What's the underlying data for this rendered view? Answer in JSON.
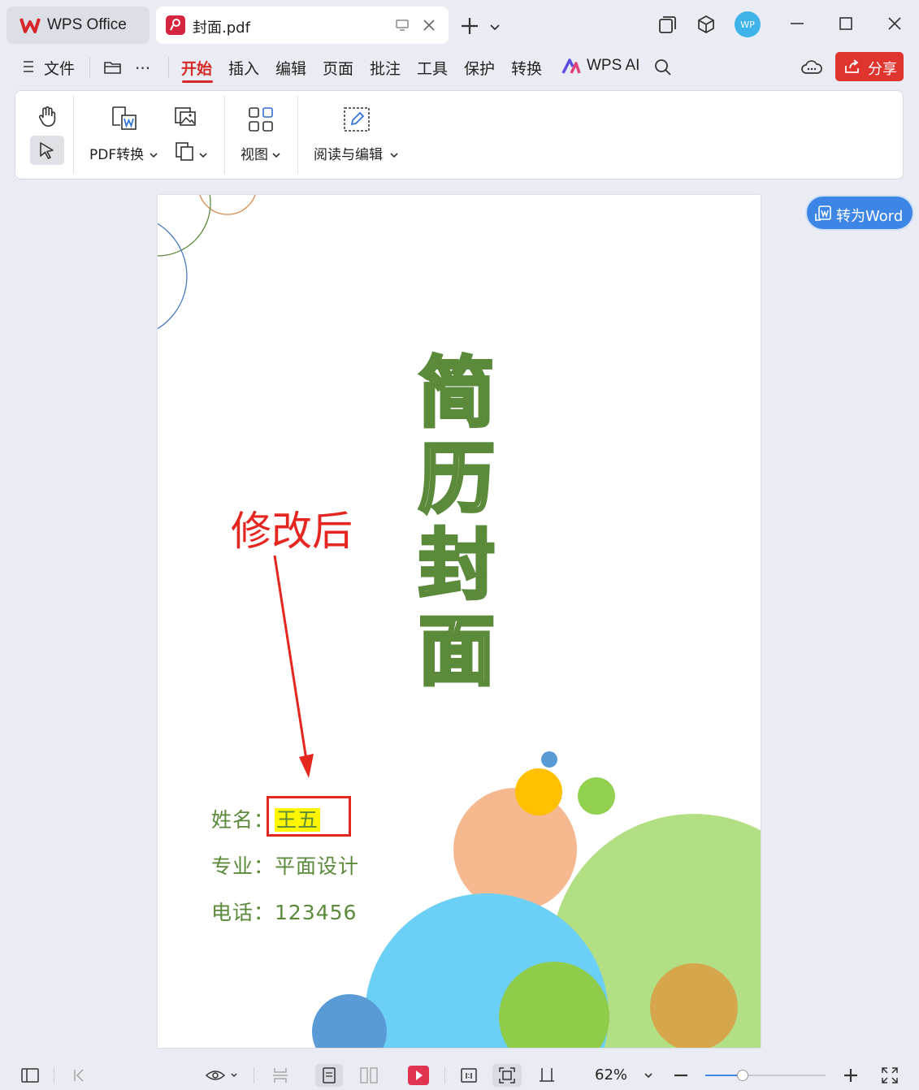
{
  "titlebar": {
    "home_tab": "WPS Office",
    "doc_tab": "封面.pdf",
    "avatar": "WP",
    "icons": [
      "wps-logo-icon",
      "pdf-icon",
      "monitor-icon",
      "close-icon",
      "plus-icon",
      "chevron-down-icon",
      "window-icon",
      "cube-icon",
      "minimize-icon",
      "maximize-icon",
      "close-icon"
    ]
  },
  "menu": {
    "file": "文件",
    "items": [
      "开始",
      "插入",
      "编辑",
      "页面",
      "批注",
      "工具",
      "保护",
      "转换"
    ],
    "ai": "WPS AI",
    "share": "分享"
  },
  "ribbon": {
    "pdf_convert": "PDF转换",
    "view": "视图",
    "read_edit": "阅读与编辑"
  },
  "document": {
    "title_chars": [
      "简",
      "历",
      "封",
      "面"
    ],
    "annotation": "修改后",
    "name_label": "姓名：",
    "name_value": "王五",
    "major": "专业：平面设计",
    "phone": "电话：123456"
  },
  "side": {
    "to_word": "转为Word"
  },
  "status": {
    "zoom": "62%",
    "zoom_fraction": 0.31
  },
  "colors": {
    "accent_red": "#d42a2a",
    "title_green": "#5a8a3a",
    "annotation_red": "#e52520",
    "highlight": "#fff600",
    "word_blue": "#3d86e6"
  }
}
